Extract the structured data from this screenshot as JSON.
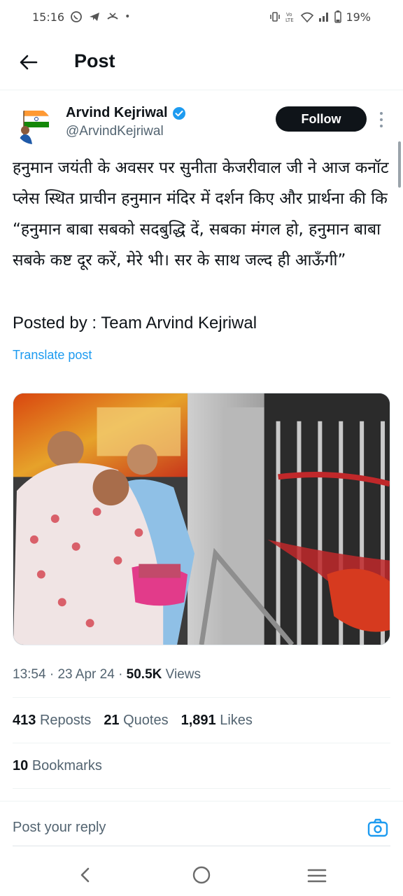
{
  "status_bar": {
    "time": "15:16",
    "battery": "19%",
    "left_icons": [
      "whatsapp-icon",
      "telegram-icon",
      "missed-call-icon",
      "dot-icon"
    ],
    "right_icons": [
      "vibrate-icon",
      "volte-icon",
      "wifi-icon",
      "signal-icon",
      "battery-icon"
    ]
  },
  "header": {
    "title": "Post"
  },
  "author": {
    "name": "Arvind Kejriwal",
    "handle": "@ArvindKejriwal",
    "follow_label": "Follow"
  },
  "post": {
    "text": "हनुमान जयंती के अवसर पर सुनीता केजरीवाल जी ने आज कनॉट प्लेस स्थित प्राचीन हनुमान मंदिर में दर्शन किए और प्रार्थना की कि “हनुमान बाबा सबको सदबुद्धि दें, सबका मंगल हो, हनुमान बाबा सबके कष्ट दूर करें, मेरे भी। सर के साथ जल्द ही आऊँगी”",
    "posted_by": "Posted by : Team Arvind Kejriwal",
    "translate_label": "Translate post"
  },
  "meta": {
    "time": "13:54",
    "date": "23 Apr 24",
    "views_count": "50.5K",
    "views_label": "Views"
  },
  "stats": {
    "reposts_count": "413",
    "reposts_label": "Reposts",
    "quotes_count": "21",
    "quotes_label": "Quotes",
    "likes_count": "1,891",
    "likes_label": "Likes",
    "bookmarks_count": "10",
    "bookmarks_label": "Bookmarks"
  },
  "reply": {
    "placeholder": "Post your reply"
  },
  "colors": {
    "link": "#1d9bf0",
    "text": "#0f1419",
    "secondary": "#536471",
    "follow_bg": "#0f1419"
  }
}
